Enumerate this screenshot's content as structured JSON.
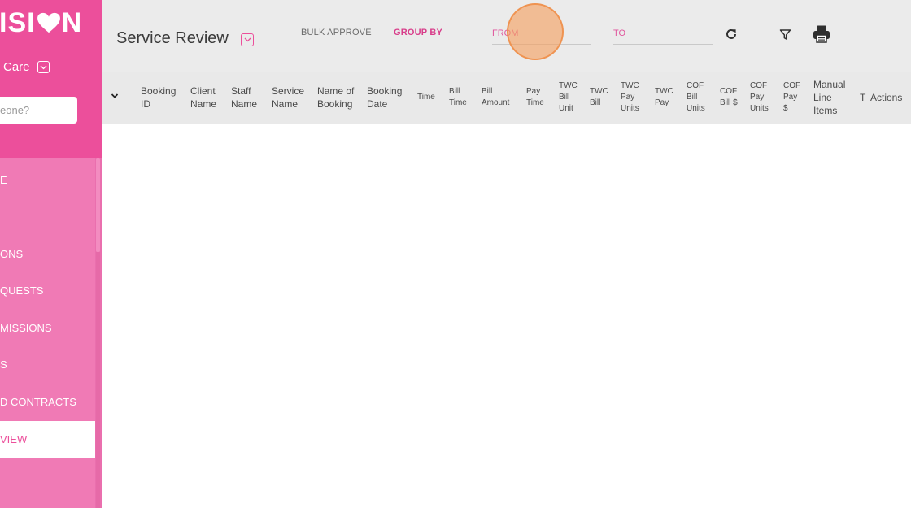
{
  "sidebar": {
    "logo_left": "ISI",
    "logo_right": "N",
    "org_name": "Care",
    "search_placeholder": "eone?",
    "nav_items": [
      {
        "label": "E"
      },
      {
        "label": "ONS"
      },
      {
        "label": "QUESTS"
      },
      {
        "label": "MISSIONS"
      },
      {
        "label": "S"
      },
      {
        "label": "D CONTRACTS"
      },
      {
        "label": "VIEW",
        "active": true
      }
    ]
  },
  "header": {
    "title": "Service Review",
    "bulk_approve": "BULK APPROVE",
    "group_by": "GROUP BY",
    "from_placeholder": "FROM",
    "to_placeholder": "TO",
    "icons": [
      "refresh-icon",
      "filter-icon",
      "print-icon"
    ]
  },
  "table": {
    "columns": [
      "Booking ID",
      "Client Name",
      "Staff Name",
      "Service Name",
      "Name of Booking",
      "Booking Date",
      "Time",
      "Bill Time",
      "Bill Amount",
      "Pay Time",
      "TWC Bill Unit",
      "TWC Bill",
      "TWC Pay Units",
      "TWC Pay",
      "COF Bill Units",
      "COF Bill $",
      "COF Pay Units",
      "COF Pay $",
      "Manual Line Items",
      "T",
      "Actions"
    ],
    "rows": []
  },
  "colors": {
    "brand_pink": "#ec4f9b",
    "sidebar_pink": "#f07ab5",
    "header_gray": "#ebebeb",
    "click_indicator": "#f5a05f"
  }
}
